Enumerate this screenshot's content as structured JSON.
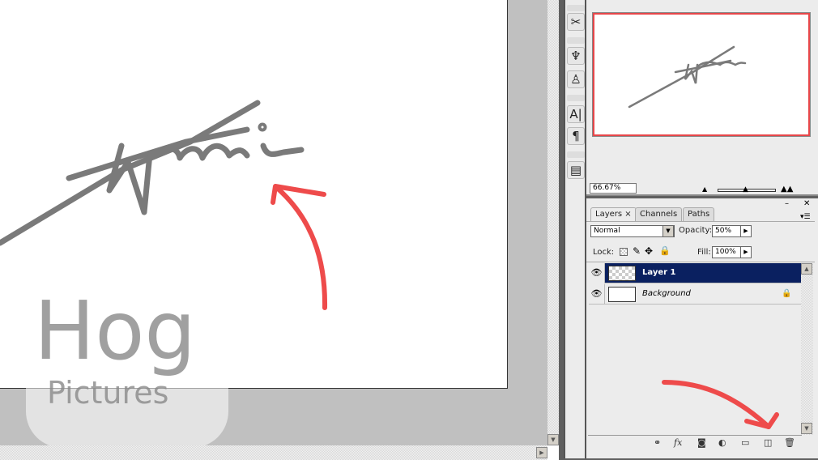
{
  "navigator": {
    "zoom": "66.67%"
  },
  "toolstrip": {
    "icons": [
      "tools-icon",
      "brushes-icon",
      "clone-source-icon",
      "character-icon",
      "paragraph-icon",
      "layer-comps-icon"
    ],
    "character_glyph": "A|",
    "paragraph_glyph": "¶"
  },
  "layers_panel": {
    "tabs": [
      {
        "label": "Layers"
      },
      {
        "label": "Channels"
      },
      {
        "label": "Paths"
      }
    ],
    "blend_mode": "Normal",
    "opacity_label": "Opacity:",
    "opacity": "50%",
    "lock_label": "Lock:",
    "fill_label": "Fill:",
    "fill": "100%",
    "layers": [
      {
        "name": "Layer 1",
        "selected": true,
        "visible": true
      },
      {
        "name": "Background",
        "selected": false,
        "visible": true,
        "locked": true
      }
    ]
  },
  "watermark": {
    "line1": "Hog",
    "line2": "Pictures"
  },
  "colors": {
    "selection": "#0a2060",
    "annotation": "#ee4b4b",
    "navigator_frame": "#e8474a"
  }
}
